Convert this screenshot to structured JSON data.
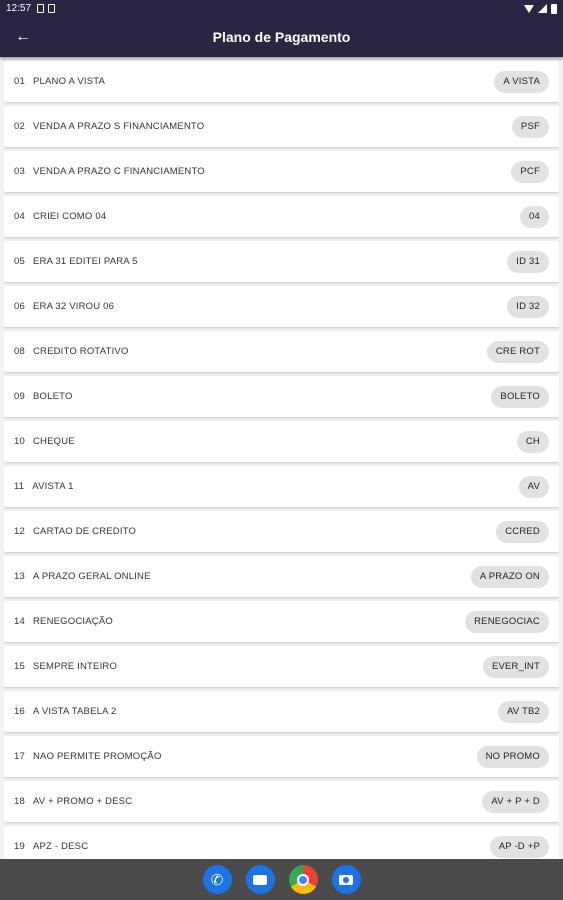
{
  "status_bar": {
    "time": "12:57"
  },
  "app_bar": {
    "title": "Plano de Pagamento",
    "back_icon": "arrow-left-icon"
  },
  "items": [
    {
      "code": "01",
      "label": "PLANO A VISTA",
      "chip": "A VISTA"
    },
    {
      "code": "02",
      "label": "VENDA  A PRAZO S FINANCIAMENTO",
      "chip": "PSF"
    },
    {
      "code": "03",
      "label": "VENDA  A PRAZO C FINANCIAMENTO",
      "chip": "PCF"
    },
    {
      "code": "04",
      "label": "CRIEI COMO 04",
      "chip": "04"
    },
    {
      "code": "05",
      "label": "ERA 31 EDITEI PARA 5",
      "chip": "ID 31"
    },
    {
      "code": "06",
      "label": "ERA 32 VIROU 06",
      "chip": "ID 32"
    },
    {
      "code": "08",
      "label": "CREDITO ROTATIVO",
      "chip": "CRE ROT"
    },
    {
      "code": "09",
      "label": "BOLETO",
      "chip": "BOLETO"
    },
    {
      "code": "10",
      "label": "CHEQUE",
      "chip": "CH"
    },
    {
      "code": "11",
      "label": "AVISTA 1",
      "chip": "AV"
    },
    {
      "code": "12",
      "label": "CARTAO DE CREDITO",
      "chip": "CCRED"
    },
    {
      "code": "13",
      "label": "A PRAZO GERAL ONLINE",
      "chip": "A PRAZO ON"
    },
    {
      "code": "14",
      "label": "RENEGOCIAÇÃO",
      "chip": "RENEGOCIAC"
    },
    {
      "code": "15",
      "label": "SEMPRE INTEIRO",
      "chip": "EVER_INT"
    },
    {
      "code": "16",
      "label": "A VISTA TABELA 2",
      "chip": "AV TB2"
    },
    {
      "code": "17",
      "label": "NAO PERMITE PROMOÇÃO",
      "chip": "NO PROMO"
    },
    {
      "code": "18",
      "label": "AV + PROMO + DESC",
      "chip": "AV + P + D"
    },
    {
      "code": "19",
      "label": "APZ - DESC",
      "chip": "AP -D +P"
    }
  ],
  "dock": [
    {
      "name": "phone-app-icon",
      "icon": "phone-icon"
    },
    {
      "name": "messages-app-icon",
      "icon": "message-icon"
    },
    {
      "name": "chrome-app-icon",
      "icon": "chrome-icon"
    },
    {
      "name": "camera-app-icon",
      "icon": "camera-icon"
    }
  ],
  "colors": {
    "app_bar": "#2a2542",
    "nav_bar": "#4b4b4b",
    "chip": "#e2e2e2",
    "background": "#f2f2f2"
  }
}
